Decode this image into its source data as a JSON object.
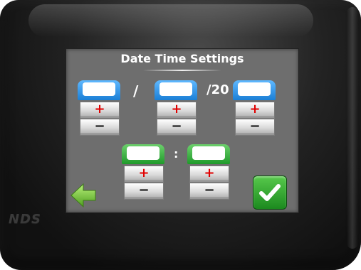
{
  "device": {
    "brand": "NDS"
  },
  "screen": {
    "title": "Date Time Settings",
    "date": {
      "separator_1": "/",
      "separator_2": "/20",
      "fields": [
        {
          "value": "",
          "plus": "+",
          "minus": "−"
        },
        {
          "value": "",
          "plus": "+",
          "minus": "−"
        },
        {
          "value": "",
          "plus": "+",
          "minus": "−"
        }
      ]
    },
    "time": {
      "separator": ":",
      "fields": [
        {
          "value": "",
          "plus": "+",
          "minus": "−"
        },
        {
          "value": "",
          "plus": "+",
          "minus": "−"
        }
      ]
    },
    "back_icon": "left-arrow-icon",
    "confirm_icon": "checkmark-icon"
  },
  "colors": {
    "date_field": "#1a7fd6",
    "time_field": "#1f9a2a",
    "plus_sign": "#e10000",
    "confirm": "#1c8a1f",
    "back_arrow": "#7ac943",
    "screen_bg": "#6e6e6e"
  }
}
